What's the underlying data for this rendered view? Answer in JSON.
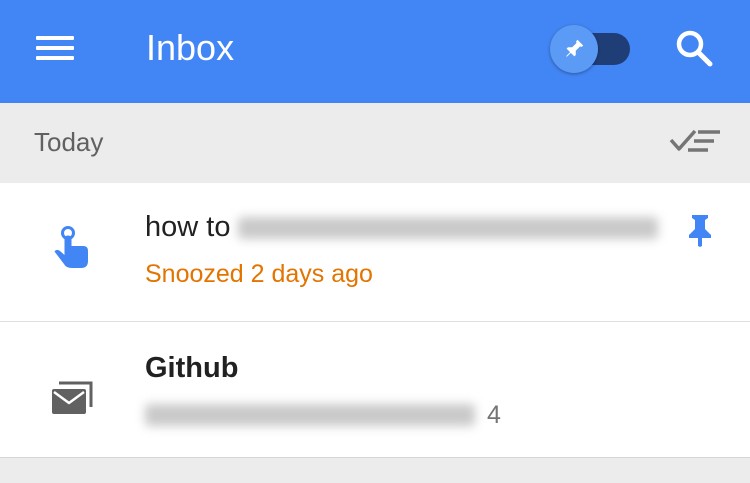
{
  "appbar": {
    "title": "Inbox",
    "menu_icon": "menu-icon",
    "pin_toggle_icon": "pin-icon",
    "search_icon": "search-icon",
    "color": "#4285f4"
  },
  "section": {
    "label": "Today",
    "action_icon": "sweep-done-icon"
  },
  "items": [
    {
      "title_prefix": "how to",
      "subtitle": "Snoozed 2 days ago",
      "subtitle_color": "#e37400",
      "icon": "reminder-hand-icon",
      "pinned": true,
      "pinned_icon": "pin-icon"
    },
    {
      "title": "Github",
      "count": "4",
      "icon": "email-stack-icon"
    }
  ]
}
